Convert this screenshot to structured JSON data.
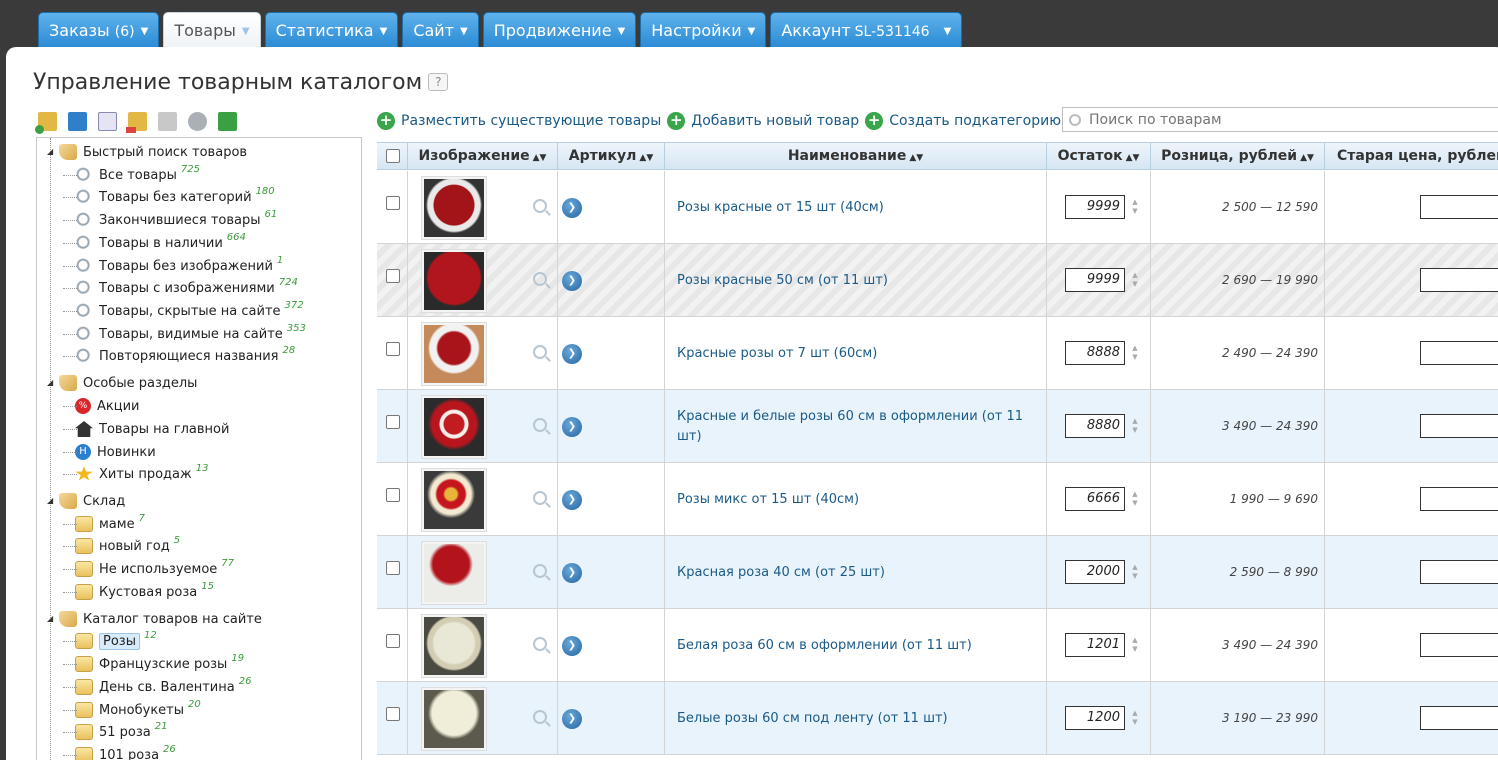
{
  "nav": {
    "tabs": [
      {
        "label": "Заказы",
        "count": "(6)"
      },
      {
        "label": "Товары"
      },
      {
        "label": "Статистика"
      },
      {
        "label": "Сайт"
      },
      {
        "label": "Продвижение"
      },
      {
        "label": "Настройки"
      },
      {
        "label": "Аккаунт",
        "account": "SL-531146"
      }
    ]
  },
  "page": {
    "title": "Управление товарным каталогом",
    "help": "?"
  },
  "tree": {
    "quick": {
      "label": "Быстрый поиск товаров",
      "items": [
        {
          "label": "Все товары",
          "count": "725"
        },
        {
          "label": "Товары без категорий",
          "count": "180"
        },
        {
          "label": "Закончившиеся товары",
          "count": "61"
        },
        {
          "label": "Товары в наличии",
          "count": "664"
        },
        {
          "label": "Товары без изображений",
          "count": "1"
        },
        {
          "label": "Товары с изображениями",
          "count": "724"
        },
        {
          "label": "Товары, скрытые на сайте",
          "count": "372"
        },
        {
          "label": "Товары, видимые на сайте",
          "count": "353"
        },
        {
          "label": "Повторяющиеся названия",
          "count": "28"
        }
      ]
    },
    "special": {
      "label": "Особые разделы",
      "items": [
        {
          "label": "Акции"
        },
        {
          "label": "Товары на главной"
        },
        {
          "label": "Новинки"
        },
        {
          "label": "Хиты продаж",
          "count": "13"
        }
      ]
    },
    "warehouse": {
      "label": "Склад",
      "items": [
        {
          "label": "маме",
          "count": "7"
        },
        {
          "label": "новый год",
          "count": "5"
        },
        {
          "label": "Не используемое",
          "count": "77"
        },
        {
          "label": "Кустовая роза",
          "count": "15"
        }
      ]
    },
    "catalog": {
      "label": "Каталог товаров на сайте",
      "items": [
        {
          "label": "Розы",
          "count": "12"
        },
        {
          "label": "Французские розы",
          "count": "19"
        },
        {
          "label": "День св. Валентина",
          "count": "26"
        },
        {
          "label": "Монобукеты",
          "count": "20"
        },
        {
          "label": "51 роза",
          "count": "21"
        },
        {
          "label": "101 роза",
          "count": "26"
        }
      ]
    }
  },
  "actions": {
    "place": "Разместить существующие товары",
    "add": "Добавить новый товар",
    "subcat": "Создать подкатегорию"
  },
  "search": {
    "placeholder": "Поиск по товарам"
  },
  "table": {
    "columns": {
      "image": "Изображение",
      "sku": "Артикул",
      "name": "Наименование",
      "stock": "Остаток",
      "retail": "Розница, рублей",
      "old": "Старая цена, рублей"
    },
    "rows": [
      {
        "name": "Розы красные от 15 шт (40см)",
        "stock": "9999",
        "retail": "2 500 — 12 590"
      },
      {
        "name": "Розы красные 50 см (от 11 шт)",
        "stock": "9999",
        "retail": "2 690 — 19 990"
      },
      {
        "name": "Красные розы от 7 шт (60см)",
        "stock": "8888",
        "retail": "2 490 — 24 390"
      },
      {
        "name": "Красные и белые розы 60 см в оформлении (от 11 шт)",
        "stock": "8880",
        "retail": "3 490 — 24 390"
      },
      {
        "name": "Розы микс от 15 шт (40см)",
        "stock": "6666",
        "retail": "1 990 — 9 690"
      },
      {
        "name": "Красная роза 40 см (от 25 шт)",
        "stock": "2000",
        "retail": "2 590 — 8 990"
      },
      {
        "name": "Белая роза 60 см в оформлении (от 11 шт)",
        "stock": "1201",
        "retail": "3 490 — 24 390"
      },
      {
        "name": "Белые розы 60 см под ленту (от 11 шт)",
        "stock": "1200",
        "retail": "3 190 — 23 990"
      }
    ]
  },
  "colors": {
    "tab": "#2a8ad4",
    "link": "#1a5a87",
    "count": "#3a9a3a",
    "row_alt": "#e9f3fb",
    "add": "#3aa54a"
  }
}
